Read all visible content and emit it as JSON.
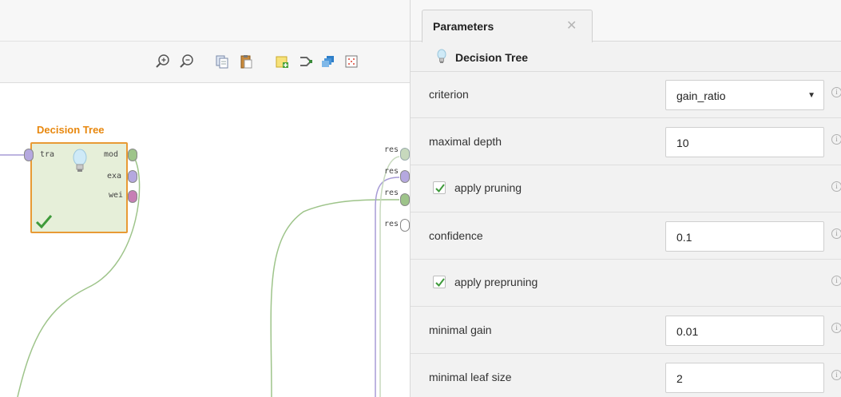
{
  "colors": {
    "operator_title": "#e8880f",
    "operator_fill": "#e6efd9",
    "operator_border": "#e89a35",
    "connection_green": "#9ec48a",
    "connection_purple": "#a79bd6",
    "check_green": "#3e9a3a"
  },
  "toolbar": {
    "icons": [
      "zoom-in-icon",
      "zoom-out-icon",
      "copy-icon",
      "paste-icon",
      "add-note-icon",
      "connect-icon",
      "layers-icon",
      "grid-icon"
    ]
  },
  "operator": {
    "title": "Decision Tree",
    "input_ports": [
      "tra"
    ],
    "output_ports": [
      "mod",
      "exa",
      "wei"
    ],
    "icon": "lightbulb-icon",
    "status_icon": "checkmark-icon"
  },
  "result_ports": [
    "res",
    "res",
    "res",
    "res"
  ],
  "panel": {
    "tab_label": "Parameters",
    "operator_name": "Decision Tree",
    "params": [
      {
        "label": "criterion",
        "kind": "dropdown",
        "value": "gain_ratio"
      },
      {
        "label": "maximal depth",
        "kind": "text",
        "value": "10"
      },
      {
        "label": "apply pruning",
        "kind": "checkbox",
        "checked": true
      },
      {
        "label": "confidence",
        "kind": "text",
        "value": "0.1"
      },
      {
        "label": "apply prepruning",
        "kind": "checkbox",
        "checked": true
      },
      {
        "label": "minimal gain",
        "kind": "text",
        "value": "0.01"
      },
      {
        "label": "minimal leaf size",
        "kind": "text",
        "value": "2"
      }
    ]
  }
}
